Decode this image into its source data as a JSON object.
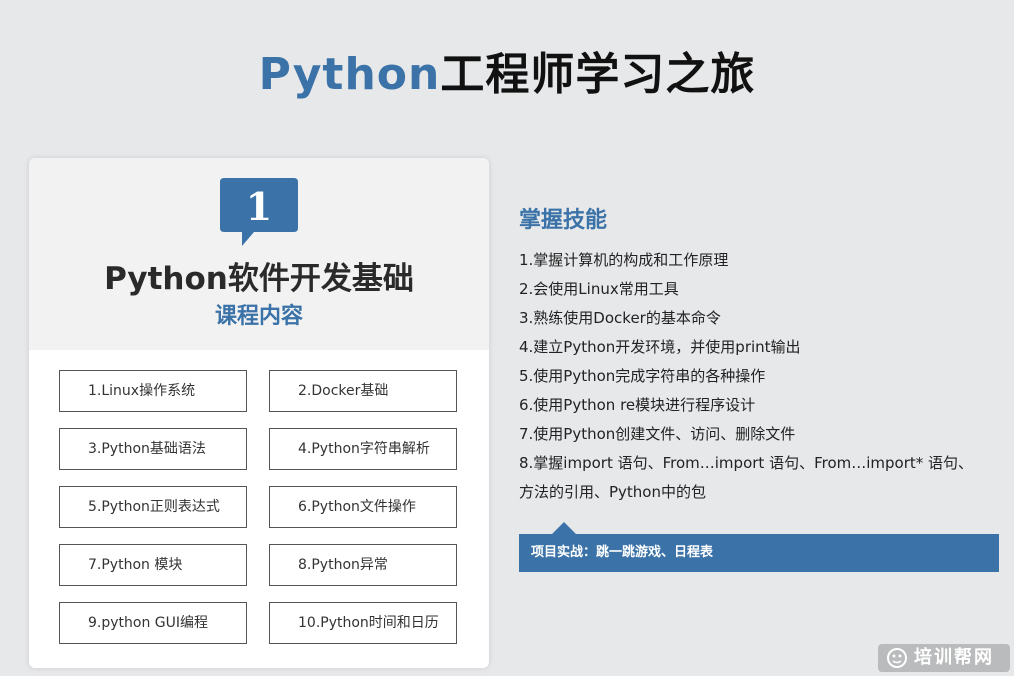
{
  "page_title": {
    "accent": "Python",
    "rest": "工程师学习之旅"
  },
  "card": {
    "badge_number": "1",
    "title": "Python软件开发基础",
    "subtitle": "课程内容",
    "modules": [
      "1.Linux操作系统",
      "2.Docker基础",
      "3.Python基础语法",
      "4.Python字符串解析",
      "5.Python正则表达式",
      "6.Python文件操作",
      "7.Python 模块",
      "8.Python异常",
      "9.python GUI编程",
      "10.Python时间和日历"
    ]
  },
  "skills": {
    "title": "掌握技能",
    "items": [
      "1.掌握计算机的构成和工作原理",
      "2.会使用Linux常用工具",
      "3.熟练使用Docker的基本命令",
      "4.建立Python开发环境，并使用print输出",
      "5.使用Python完成字符串的各种操作",
      "6.使用Python re模块进行程序设计",
      "7.使用Python创建文件、访问、删除文件",
      "8.掌握import 语句、From…import 语句、From…import* 语句、",
      "方法的引用、Python中的包"
    ]
  },
  "project": {
    "label": "项目实战：跳一跳游戏、日程表"
  },
  "watermark": {
    "text": "培训帮网"
  },
  "colors": {
    "accent": "#3b73a8",
    "background": "#e7e8ea",
    "header_gray": "#f2f2f2"
  }
}
